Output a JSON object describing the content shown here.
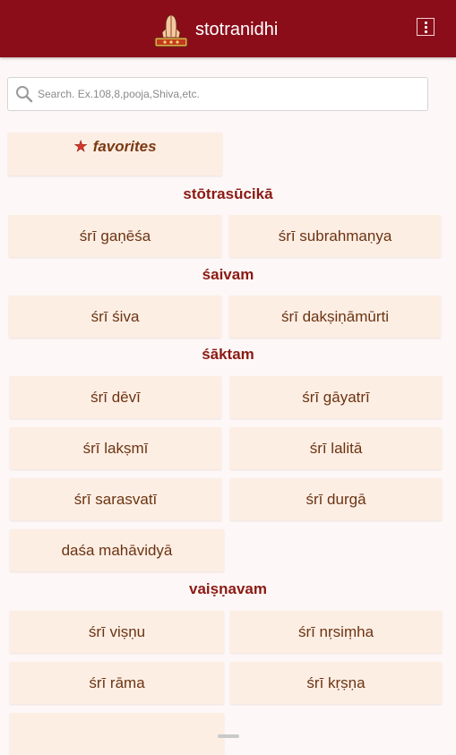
{
  "header": {
    "title": "stotranidhi",
    "background_color": "#8b0d1a",
    "logo_icon": "namaste-hands-icon",
    "menu_icon": "more-vertical-icon"
  },
  "search": {
    "placeholder": "Search. Ex.108,8,pooja,Shiva,etc.",
    "value": ""
  },
  "favorites": {
    "label": "favorites",
    "icon": "star-icon"
  },
  "sections": [
    {
      "heading": "stōtrasūcikā",
      "items": [
        "śrī gaṇēśa",
        "śrī subrahmaṇya"
      ]
    },
    {
      "heading": "śaivam",
      "items": [
        "śrī śiva",
        "śrī dakṣiṇāmūrti"
      ]
    },
    {
      "heading": "śāktam",
      "items": [
        "śrī dēvī",
        "śrī gāyatrī",
        "śrī lakṣmī",
        "śrī lalitā",
        "śrī sarasvatī",
        "śrī durgā",
        "daśa mahāvidyā"
      ]
    },
    {
      "heading": "vaiṣṇavam",
      "items": [
        "śrī viṣṇu",
        "śrī nṛsiṃha",
        "śrī rāma",
        "śrī kṛṣṇa"
      ]
    }
  ],
  "colors": {
    "tile_background": "#fdeee4",
    "tile_text": "#6b3412",
    "section_heading": "#8b1a14",
    "favorite_star": "#d9342b"
  }
}
